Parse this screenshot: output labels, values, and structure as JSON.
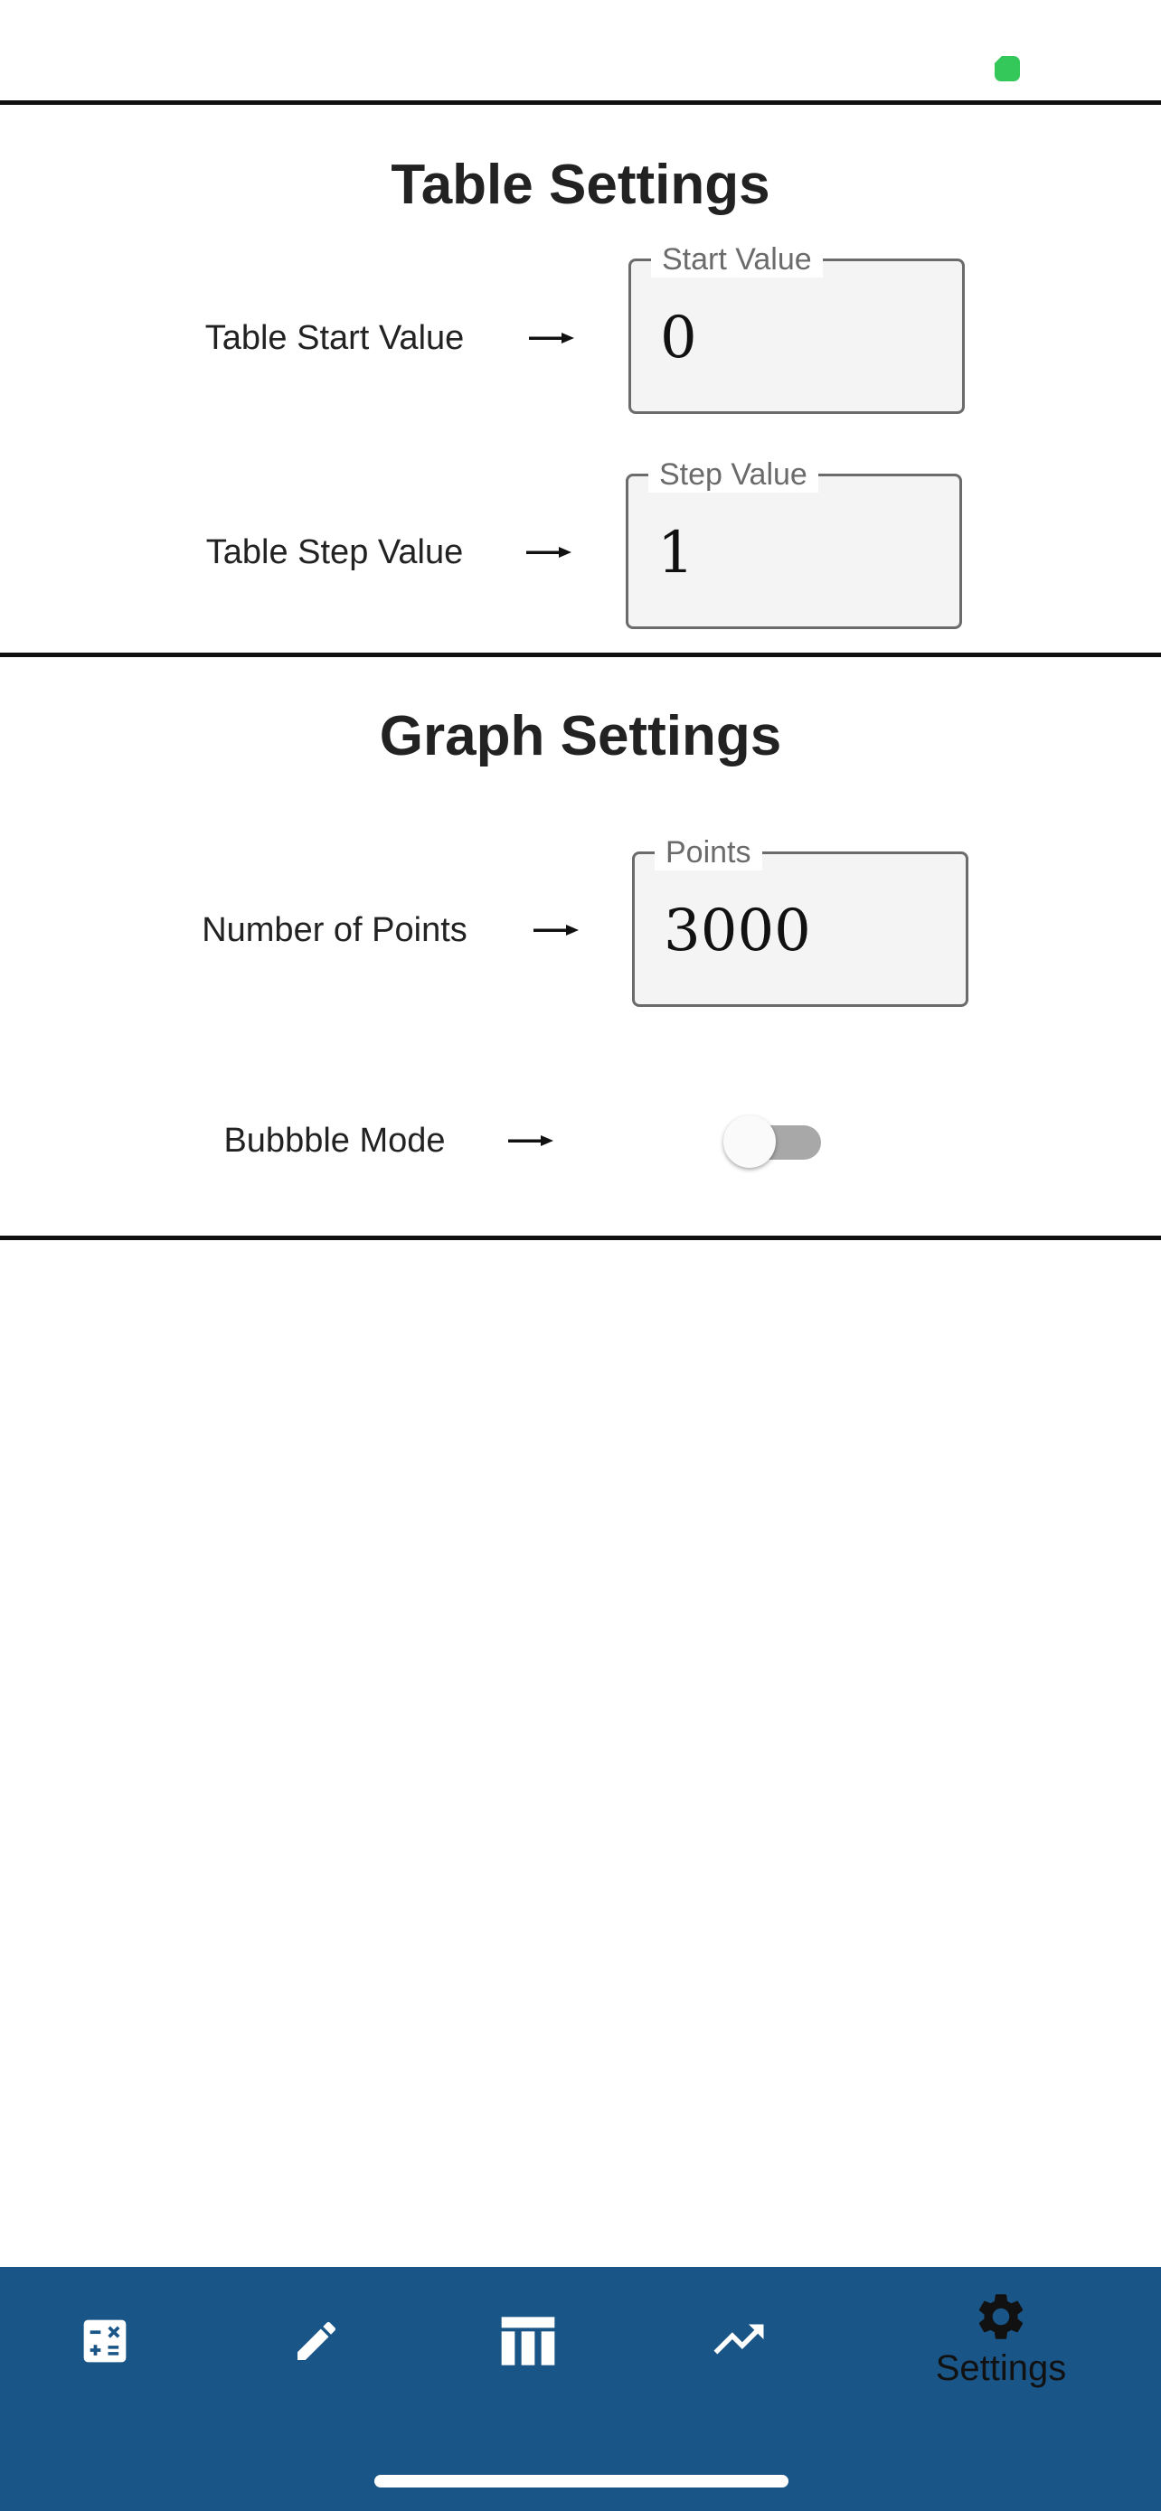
{
  "table_settings": {
    "title": "Table Settings",
    "start": {
      "label": "Table Start Value",
      "field_label": "Start Value",
      "value": "0"
    },
    "step": {
      "label": "Table Step Value",
      "field_label": "Step Value",
      "value": "1"
    }
  },
  "graph_settings": {
    "title": "Graph Settings",
    "points": {
      "label": "Number of Points",
      "field_label": "Points",
      "value": "3000"
    },
    "bubble_mode": {
      "label": "Bubbble Mode",
      "enabled": false
    }
  },
  "bottom_nav": {
    "active": "settings",
    "items": [
      {
        "id": "calculator",
        "icon": "calculator-icon",
        "label": ""
      },
      {
        "id": "edit",
        "icon": "pencil-icon",
        "label": ""
      },
      {
        "id": "table",
        "icon": "table-icon",
        "label": ""
      },
      {
        "id": "graph",
        "icon": "trending-up-icon",
        "label": ""
      },
      {
        "id": "settings",
        "icon": "gear-icon",
        "label": "Settings"
      }
    ]
  },
  "colors": {
    "nav_background": "#1a5587",
    "status_indicator": "#34c759",
    "toggle_track_off": "#a8a8a8"
  }
}
